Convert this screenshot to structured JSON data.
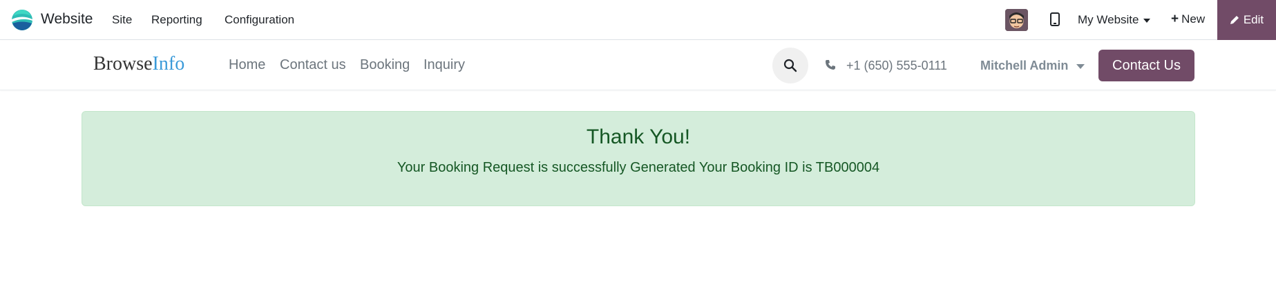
{
  "admin_bar": {
    "app_name": "Website",
    "menu": [
      "Site",
      "Reporting",
      "Configuration"
    ],
    "my_website": "My Website",
    "new_label": "New",
    "edit_label": "Edit",
    "accent_color": "#714b67"
  },
  "site_header": {
    "brand_part1": "Browse",
    "brand_part2": "Info",
    "nav": [
      "Home",
      "Contact us",
      "Booking",
      "Inquiry"
    ],
    "phone": "+1 (650) 555-0111",
    "user": "Mitchell Admin",
    "contact_button": "Contact Us"
  },
  "alert": {
    "title": "Thank You!",
    "message": "Your Booking Request is successfully Generated Your Booking ID is TB000004",
    "background": "#d4eddb",
    "text_color": "#155724"
  },
  "icons": {
    "app_logo": "website-logo-icon",
    "avatar": "user-avatar",
    "mobile": "mobile-preview-icon",
    "search": "search-icon",
    "phone": "phone-icon",
    "edit": "pencil-icon",
    "new": "plus-icon"
  }
}
